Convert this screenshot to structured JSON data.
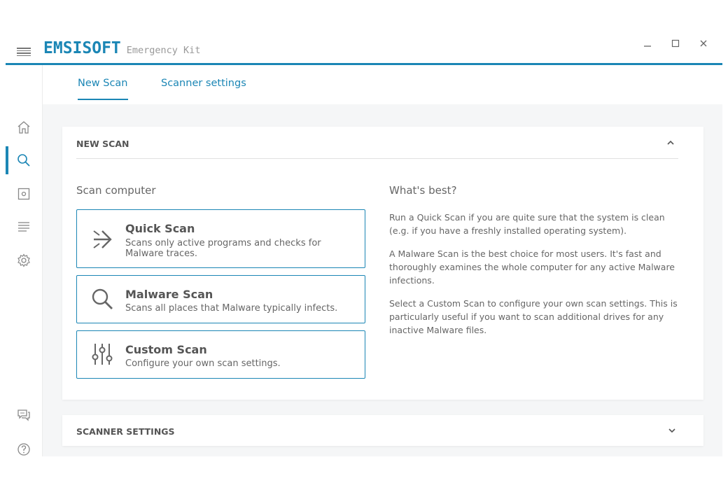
{
  "app": {
    "brand_name": "EMSISOFT",
    "brand_sub": "Emergency Kit"
  },
  "tabs": [
    {
      "label": "New Scan",
      "active": true
    },
    {
      "label": "Scanner settings",
      "active": false
    }
  ],
  "new_scan_panel": {
    "title": "NEW SCAN",
    "scan_computer_title": "Scan computer",
    "scans": [
      {
        "name": "Quick Scan",
        "description": "Scans only active programs and checks for Malware traces.",
        "icon": "quick-scan-arrows-icon"
      },
      {
        "name": "Malware Scan",
        "description": "Scans all places that Malware typically infects.",
        "icon": "magnifier-icon"
      },
      {
        "name": "Custom Scan",
        "description": "Configure your own scan settings.",
        "icon": "sliders-icon"
      }
    ],
    "whats_best_title": "What's best?",
    "whats_best_paragraphs": [
      "Run a Quick Scan if you are quite sure that the system is clean (e.g. if you have a freshly installed operating system).",
      "A Malware Scan is the best choice for most users. It's fast and thoroughly examines the whole computer for any active Malware infections.",
      "Select a Custom Scan to configure your own scan settings. This is particularly useful if you want to scan additional drives for any inactive Malware files."
    ]
  },
  "scanner_settings_panel": {
    "title": "SCANNER SETTINGS"
  },
  "colors": {
    "accent": "#1b86b5",
    "text": "#555555",
    "muted": "#999999",
    "background": "#f5f6f7"
  }
}
